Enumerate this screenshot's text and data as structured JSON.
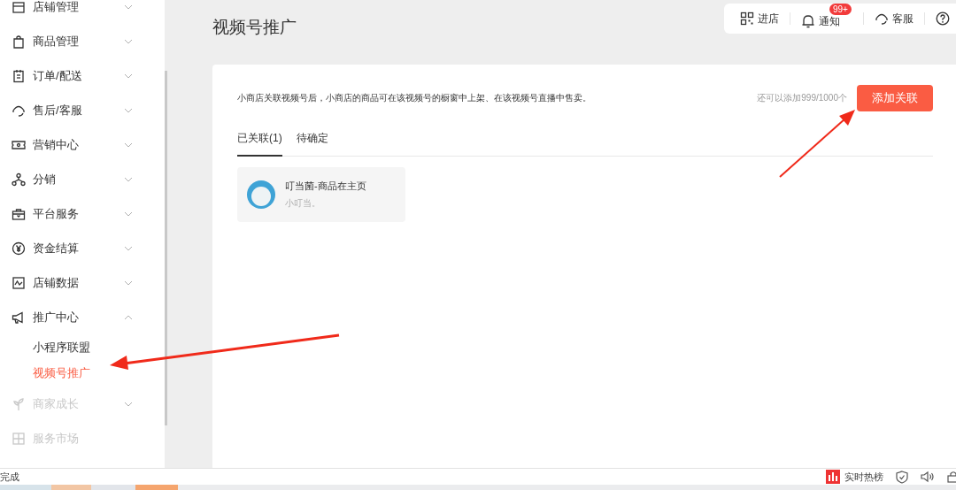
{
  "sidebar": {
    "items": [
      {
        "label": "店铺管理",
        "expanded": false,
        "faded": false
      },
      {
        "label": "商品管理",
        "expanded": false,
        "faded": false
      },
      {
        "label": "订单/配送",
        "expanded": false,
        "faded": false
      },
      {
        "label": "售后/客服",
        "expanded": false,
        "faded": false
      },
      {
        "label": "营销中心",
        "expanded": false,
        "faded": false
      },
      {
        "label": "分销",
        "expanded": false,
        "faded": false
      },
      {
        "label": "平台服务",
        "expanded": false,
        "faded": false
      },
      {
        "label": "资金结算",
        "expanded": false,
        "faded": false
      },
      {
        "label": "店铺数据",
        "expanded": false,
        "faded": false
      },
      {
        "label": "推广中心",
        "expanded": true,
        "faded": false,
        "children": [
          {
            "label": "小程序联盟",
            "selected": false
          },
          {
            "label": "视频号推广",
            "selected": true
          }
        ]
      },
      {
        "label": "商家成长",
        "expanded": false,
        "faded": true
      },
      {
        "label": "服务市场",
        "faded": true
      }
    ]
  },
  "page_title": "视频号推广",
  "toolbar": [
    {
      "label": "进店"
    },
    {
      "label": "通知",
      "badge": "99+"
    },
    {
      "label": "客服"
    }
  ],
  "card": {
    "description": "小商店关联视频号后，小商店的商品可在该视频号的橱窗中上架、在该视频号直播中售卖。",
    "quota": "还可以添加999/1000个",
    "add_button": "添加关联",
    "tabs": [
      {
        "label": "已关联(1)",
        "selected": true
      },
      {
        "label": "待确定",
        "selected": false
      }
    ],
    "channels": [
      {
        "name": "叮当菌-商品在主页",
        "subtitle": "小叮当。"
      }
    ]
  },
  "status_bar": {
    "left": "完成",
    "hot_list": "实时热榜"
  }
}
